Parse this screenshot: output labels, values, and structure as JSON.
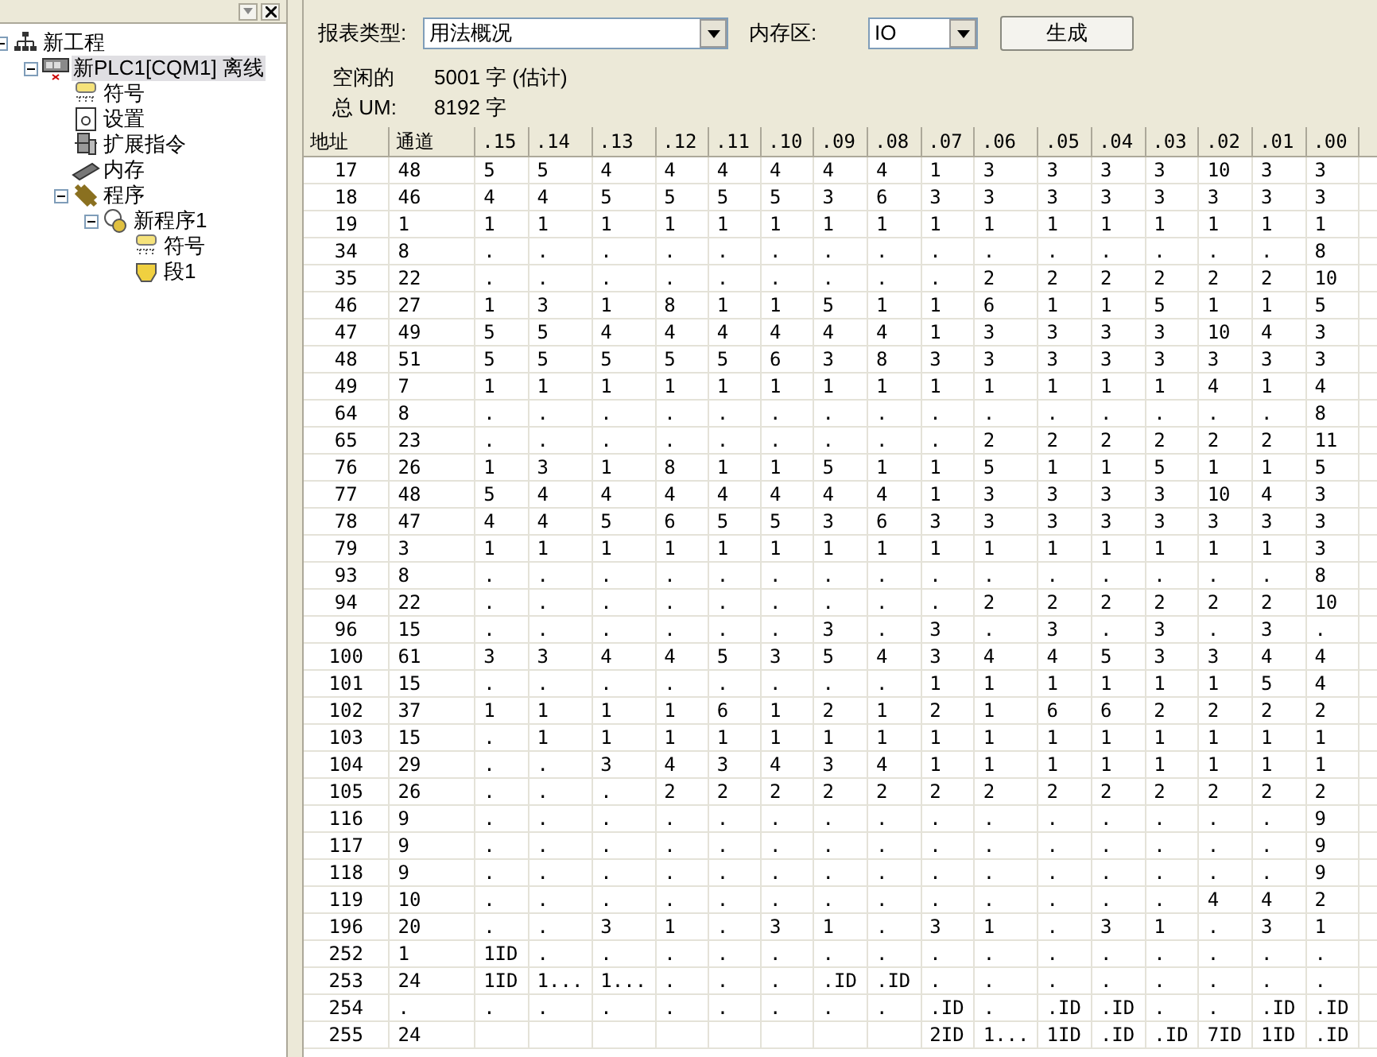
{
  "project_tree": {
    "items": [
      {
        "label": "新工程",
        "kind": "project",
        "selected": false,
        "expanded": true,
        "children": [
          {
            "label": "新PLC1[CQM1] 离线",
            "kind": "plc",
            "selected": true,
            "expanded": true,
            "children": [
              {
                "label": "符号",
                "kind": "symbols",
                "selected": false
              },
              {
                "label": "设置",
                "kind": "settings",
                "selected": false
              },
              {
                "label": "扩展指令",
                "kind": "expansion",
                "selected": false
              },
              {
                "label": "内存",
                "kind": "memory",
                "selected": false
              },
              {
                "label": "程序",
                "kind": "programs",
                "selected": false,
                "expanded": true,
                "children": [
                  {
                    "label": "新程序1",
                    "kind": "program",
                    "selected": false,
                    "expanded": true,
                    "children": [
                      {
                        "label": "符号",
                        "kind": "symbols",
                        "selected": false
                      },
                      {
                        "label": "段1",
                        "kind": "section",
                        "selected": false
                      }
                    ]
                  }
                ]
              }
            ]
          }
        ]
      }
    ]
  },
  "report": {
    "type_label": "报表类型:",
    "type_value": "用法概况",
    "area_label": "内存区:",
    "area_value": "IO",
    "generate_button": "生成",
    "free_label": "空闲的",
    "free_value": "5001 字 (估计)",
    "total_label": "总 UM:",
    "total_value": "8192 字"
  },
  "table": {
    "columns": [
      "地址",
      "通道",
      ".15",
      ".14",
      ".13",
      ".12",
      ".11",
      ".10",
      ".09",
      ".08",
      ".07",
      ".06",
      ".05",
      ".04",
      ".03",
      ".02",
      ".01",
      ".00"
    ],
    "rows": [
      [
        "17",
        "48",
        "5",
        "5",
        "4",
        "4",
        "4",
        "4",
        "4",
        "4",
        "1",
        "3",
        "3",
        "3",
        "3",
        "10",
        "3",
        "3"
      ],
      [
        "18",
        "46",
        "4",
        "4",
        "5",
        "5",
        "5",
        "5",
        "3",
        "6",
        "3",
        "3",
        "3",
        "3",
        "3",
        "3",
        "3",
        "3"
      ],
      [
        "19",
        "1",
        "1",
        "1",
        "1",
        "1",
        "1",
        "1",
        "1",
        "1",
        "1",
        "1",
        "1",
        "1",
        "1",
        "1",
        "1",
        "1"
      ],
      [
        "34",
        "8",
        ".",
        ".",
        ".",
        ".",
        ".",
        ".",
        ".",
        ".",
        ".",
        ".",
        ".",
        ".",
        ".",
        ".",
        ".",
        "8"
      ],
      [
        "35",
        "22",
        ".",
        ".",
        ".",
        ".",
        ".",
        ".",
        ".",
        ".",
        ".",
        "2",
        "2",
        "2",
        "2",
        "2",
        "2",
        "10"
      ],
      [
        "46",
        "27",
        "1",
        "3",
        "1",
        "8",
        "1",
        "1",
        "5",
        "1",
        "1",
        "6",
        "1",
        "1",
        "5",
        "1",
        "1",
        "5"
      ],
      [
        "47",
        "49",
        "5",
        "5",
        "4",
        "4",
        "4",
        "4",
        "4",
        "4",
        "1",
        "3",
        "3",
        "3",
        "3",
        "10",
        "4",
        "3"
      ],
      [
        "48",
        "51",
        "5",
        "5",
        "5",
        "5",
        "5",
        "6",
        "3",
        "8",
        "3",
        "3",
        "3",
        "3",
        "3",
        "3",
        "3",
        "3"
      ],
      [
        "49",
        "7",
        "1",
        "1",
        "1",
        "1",
        "1",
        "1",
        "1",
        "1",
        "1",
        "1",
        "1",
        "1",
        "1",
        "4",
        "1",
        "4"
      ],
      [
        "64",
        "8",
        ".",
        ".",
        ".",
        ".",
        ".",
        ".",
        ".",
        ".",
        ".",
        ".",
        ".",
        ".",
        ".",
        ".",
        ".",
        "8"
      ],
      [
        "65",
        "23",
        ".",
        ".",
        ".",
        ".",
        ".",
        ".",
        ".",
        ".",
        ".",
        "2",
        "2",
        "2",
        "2",
        "2",
        "2",
        "11"
      ],
      [
        "76",
        "26",
        "1",
        "3",
        "1",
        "8",
        "1",
        "1",
        "5",
        "1",
        "1",
        "5",
        "1",
        "1",
        "5",
        "1",
        "1",
        "5"
      ],
      [
        "77",
        "48",
        "5",
        "4",
        "4",
        "4",
        "4",
        "4",
        "4",
        "4",
        "1",
        "3",
        "3",
        "3",
        "3",
        "10",
        "4",
        "3"
      ],
      [
        "78",
        "47",
        "4",
        "4",
        "5",
        "6",
        "5",
        "5",
        "3",
        "6",
        "3",
        "3",
        "3",
        "3",
        "3",
        "3",
        "3",
        "3"
      ],
      [
        "79",
        "3",
        "1",
        "1",
        "1",
        "1",
        "1",
        "1",
        "1",
        "1",
        "1",
        "1",
        "1",
        "1",
        "1",
        "1",
        "1",
        "3"
      ],
      [
        "93",
        "8",
        ".",
        ".",
        ".",
        ".",
        ".",
        ".",
        ".",
        ".",
        ".",
        ".",
        ".",
        ".",
        ".",
        ".",
        ".",
        "8"
      ],
      [
        "94",
        "22",
        ".",
        ".",
        ".",
        ".",
        ".",
        ".",
        ".",
        ".",
        ".",
        "2",
        "2",
        "2",
        "2",
        "2",
        "2",
        "10"
      ],
      [
        "96",
        "15",
        ".",
        ".",
        ".",
        ".",
        ".",
        ".",
        "3",
        ".",
        "3",
        ".",
        "3",
        ".",
        "3",
        ".",
        "3",
        "."
      ],
      [
        "100",
        "61",
        "3",
        "3",
        "4",
        "4",
        "5",
        "3",
        "5",
        "4",
        "3",
        "4",
        "4",
        "5",
        "3",
        "3",
        "4",
        "4"
      ],
      [
        "101",
        "15",
        ".",
        ".",
        ".",
        ".",
        ".",
        ".",
        ".",
        ".",
        "1",
        "1",
        "1",
        "1",
        "1",
        "1",
        "5",
        "4"
      ],
      [
        "102",
        "37",
        "1",
        "1",
        "1",
        "1",
        "6",
        "1",
        "2",
        "1",
        "2",
        "1",
        "6",
        "6",
        "2",
        "2",
        "2",
        "2"
      ],
      [
        "103",
        "15",
        ".",
        "1",
        "1",
        "1",
        "1",
        "1",
        "1",
        "1",
        "1",
        "1",
        "1",
        "1",
        "1",
        "1",
        "1",
        "1"
      ],
      [
        "104",
        "29",
        ".",
        ".",
        "3",
        "4",
        "3",
        "4",
        "3",
        "4",
        "1",
        "1",
        "1",
        "1",
        "1",
        "1",
        "1",
        "1"
      ],
      [
        "105",
        "26",
        ".",
        ".",
        ".",
        "2",
        "2",
        "2",
        "2",
        "2",
        "2",
        "2",
        "2",
        "2",
        "2",
        "2",
        "2",
        "2"
      ],
      [
        "116",
        "9",
        ".",
        ".",
        ".",
        ".",
        ".",
        ".",
        ".",
        ".",
        ".",
        ".",
        ".",
        ".",
        ".",
        ".",
        ".",
        "9"
      ],
      [
        "117",
        "9",
        ".",
        ".",
        ".",
        ".",
        ".",
        ".",
        ".",
        ".",
        ".",
        ".",
        ".",
        ".",
        ".",
        ".",
        ".",
        "9"
      ],
      [
        "118",
        "9",
        ".",
        ".",
        ".",
        ".",
        ".",
        ".",
        ".",
        ".",
        ".",
        ".",
        ".",
        ".",
        ".",
        ".",
        ".",
        "9"
      ],
      [
        "119",
        "10",
        ".",
        ".",
        ".",
        ".",
        ".",
        ".",
        ".",
        ".",
        ".",
        ".",
        ".",
        ".",
        ".",
        "4",
        "4",
        "2"
      ],
      [
        "196",
        "20",
        ".",
        ".",
        "3",
        "1",
        ".",
        "3",
        "1",
        ".",
        "3",
        "1",
        ".",
        "3",
        "1",
        ".",
        "3",
        "1"
      ],
      [
        "252",
        "1",
        "1ID",
        ".",
        ".",
        ".",
        ".",
        ".",
        ".",
        ".",
        ".",
        ".",
        ".",
        ".",
        ".",
        ".",
        ".",
        "."
      ],
      [
        "253",
        "24",
        "1ID",
        "1...",
        "1...",
        ".",
        ".",
        ".",
        ".ID",
        ".ID",
        ".",
        ".",
        ".",
        ".",
        ".",
        ".",
        ".",
        "."
      ],
      [
        "254",
        ".",
        ".",
        ".",
        ".",
        ".",
        ".",
        ".",
        ".",
        ".",
        ".ID",
        ".",
        ".ID",
        ".ID",
        ".",
        ".",
        ".ID",
        ".ID"
      ],
      [
        "255",
        "24",
        null,
        null,
        null,
        null,
        null,
        null,
        null,
        null,
        "2ID",
        "1...",
        "1ID",
        ".ID",
        ".ID",
        "7ID",
        "1ID",
        ".ID"
      ]
    ]
  }
}
